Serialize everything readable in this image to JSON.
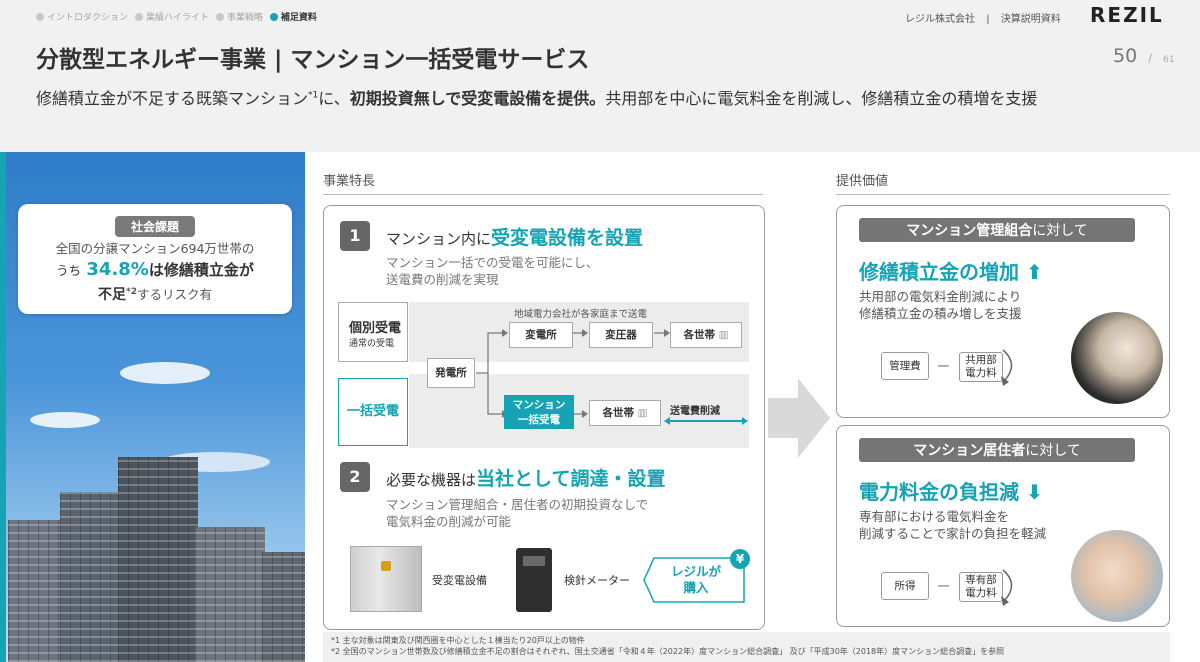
{
  "nav": {
    "crumbs": [
      {
        "label": "イントロダクション",
        "active": false
      },
      {
        "label": "業績ハイライト",
        "active": false
      },
      {
        "label": "事業戦略",
        "active": false
      },
      {
        "label": "補足資料",
        "active": true
      }
    ],
    "company": "レジル株式会社",
    "separator": "|",
    "doc_type": "決算説明資料",
    "logo": "REZIL"
  },
  "page": {
    "current": "50",
    "slash": "/",
    "total": "61"
  },
  "title": "分散型エネルギー事業 | マンション一括受電サービス",
  "subtitle": {
    "part1": "修繕積立金が不足する既築マンション",
    "sup": "*1",
    "part2": "に、",
    "bold": "初期投資無しで受変電設備を提供。",
    "part3": "共用部を中心に電気料金を削減し、修繕積立金の積増を支援"
  },
  "social_issue": {
    "badge": "社会課題",
    "line1": "全国の分譲マンション694万世帯の",
    "line2_prefix": "うち",
    "line2_pct": "34.8%",
    "line2_suffix": "は修繕積立金が",
    "line3_bold": "不足",
    "line3_sup": "*2",
    "line3_rest": "するリスク有"
  },
  "features": {
    "heading": "事業特長",
    "item1": {
      "number": "1",
      "prefix": "マンション内に",
      "highlight": "受変電設備を設置",
      "desc1": "マンション一括での受電を可能にし、",
      "desc2": "送電費の削減を実現"
    },
    "diagram": {
      "individual_label": "個別受電",
      "individual_sub": "通常の受電",
      "bulk_label": "一括受電",
      "top_note": "地域電力会社が各家庭まで送電",
      "power_plant": "発電所",
      "substation": "変電所",
      "transformer": "変圧器",
      "households_top": "各世帯",
      "bulk_box_line1": "マンション",
      "bulk_box_line2": "一括受電",
      "households_bottom": "各世帯",
      "savings": "送電費削減"
    },
    "item2": {
      "number": "2",
      "prefix": "必要な機器は",
      "highlight": "当社として調達・設置",
      "desc1": "マンション管理組合・居住者の初期投資なしで",
      "desc2": "電気料金の削減が可能"
    },
    "equipment": {
      "substation_label": "受変電設備",
      "meter_label": "検針メーター",
      "rezil_line1": "レジルが",
      "rezil_line2": "購入",
      "yen": "¥"
    }
  },
  "value": {
    "heading": "提供価値",
    "card1": {
      "pill_bold": "マンション管理組合",
      "pill_rest": "に対して",
      "headline": "修繕積立金の増加",
      "arrow": "up",
      "desc1": "共用部の電気料金削減により",
      "desc2": "修繕積立金の積み増しを支援",
      "tag_left": "管理費",
      "dash": "ー",
      "tag_right1": "共用部",
      "tag_right2": "電力料"
    },
    "card2": {
      "pill_bold": "マンション居住者",
      "pill_rest": "に対して",
      "headline": "電力料金の負担減",
      "arrow": "down",
      "desc1": "専有部における電気料金を",
      "desc2": "削減することで家計の負担を軽減",
      "tag_left": "所得",
      "dash": "ー",
      "tag_right1": "専有部",
      "tag_right2": "電力料"
    }
  },
  "footnotes": [
    "*1 主な対象は関東及び関西圏を中心とした１棟当たり20戸以上の物件",
    "*2 全国のマンション世帯数及び修繕積立金不足の割合はそれぞれ、国土交通省「令和４年（2022年）度マンション総合調査」 及び「平成30年（2018年）度マンション総合調査」を参照"
  ],
  "colors": {
    "accent": "#16a3b3",
    "pill_gray": "#757575",
    "header_bg": "#f1f1f1"
  }
}
